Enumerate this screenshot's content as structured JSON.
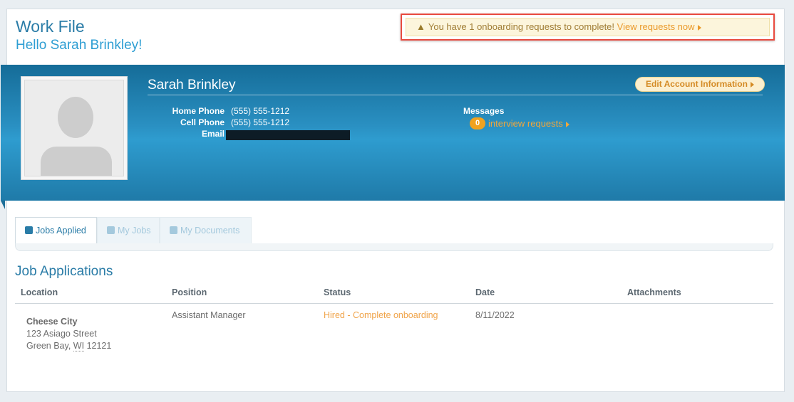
{
  "header": {
    "title": "Work File",
    "greeting": "Hello Sarah Brinkley!"
  },
  "alert": {
    "icon": "warning-icon",
    "message": "You have 1 onboarding requests to complete!",
    "link": "View requests now"
  },
  "profile": {
    "name": "Sarah Brinkley",
    "edit_label": "Edit Account Information",
    "home_phone_label": "Home Phone",
    "home_phone": "(555) 555-1212",
    "cell_phone_label": "Cell Phone",
    "cell_phone": "(555) 555-1212",
    "email_label": "Email",
    "messages_label": "Messages",
    "message_count": "0",
    "interview_link": "interview requests"
  },
  "tabs": [
    {
      "label": "Jobs Applied",
      "active": true
    },
    {
      "label": "My Jobs",
      "active": false
    },
    {
      "label": "My Documents",
      "active": false
    }
  ],
  "applications": {
    "title": "Job Applications",
    "columns": [
      "Location",
      "Position",
      "Status",
      "Date",
      "Attachments"
    ],
    "rows": [
      {
        "location_name": "Cheese City",
        "street": "123 Asiago Street",
        "city": "Green Bay,",
        "state": "WI",
        "zip": "12121",
        "position": "Assistant Manager",
        "status": "Hired - Complete onboarding",
        "date": "8/11/2022",
        "attachments": ""
      }
    ]
  },
  "colors": {
    "accent": "#2a7ca7",
    "banner": "#2e9ccf",
    "alert_border": "#e94a3f",
    "link_orange": "#f0a44a"
  }
}
